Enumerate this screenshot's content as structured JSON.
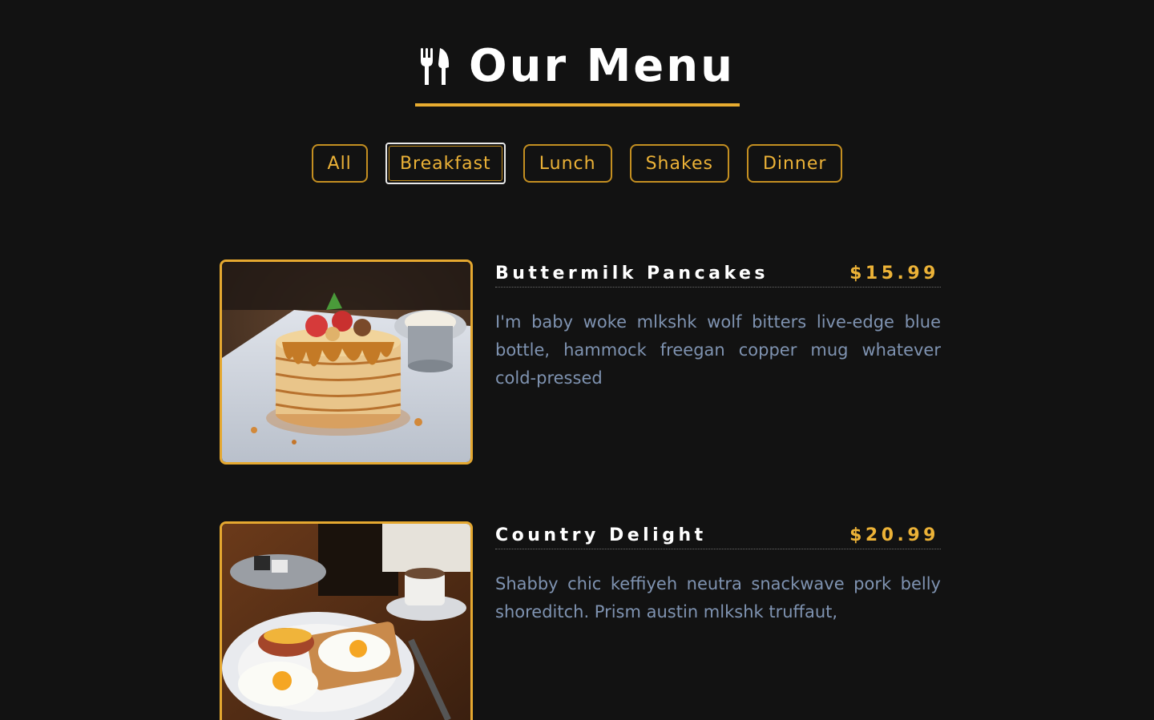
{
  "header": {
    "title": "Our Menu",
    "icon": "utensils-icon",
    "accent_color": "#e8ac30"
  },
  "filters": {
    "items": [
      {
        "label": "All"
      },
      {
        "label": "Breakfast",
        "active": true
      },
      {
        "label": "Lunch"
      },
      {
        "label": "Shakes"
      },
      {
        "label": "Dinner"
      }
    ],
    "color": "#ecb237"
  },
  "menu": {
    "items": [
      {
        "name": "Buttermilk Pancakes",
        "price": "$15.99",
        "description": "I'm baby woke mlkshk wolf bitters live-edge blue bottle, hammock freegan copper mug whatever cold-pressed",
        "image": "pancakes-photo"
      },
      {
        "name": "Country Delight",
        "price": "$20.99",
        "description": "Shabby chic keffiyeh neutra snackwave pork belly shoreditch. Prism austin mlkshk truffaut,",
        "image": "eggs-breakfast-photo"
      }
    ]
  }
}
